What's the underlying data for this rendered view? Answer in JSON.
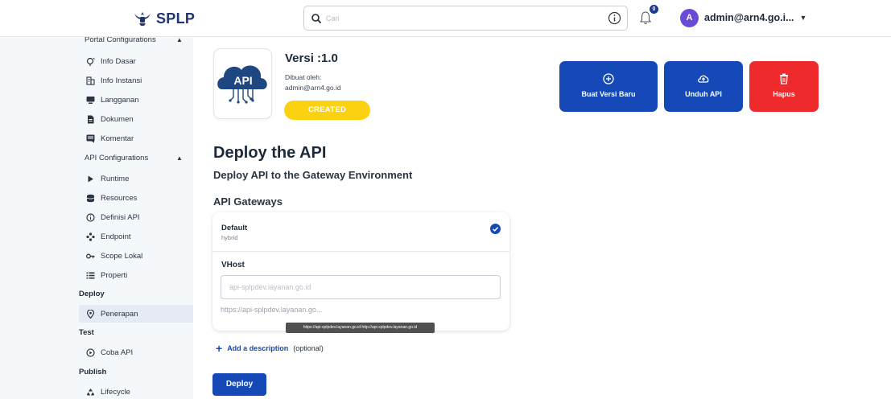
{
  "header": {
    "logo_text": "SPLP",
    "search_placeholder": "Cari",
    "notification_count": "0",
    "user_initial": "A",
    "user_name": "admin@arn4.go.i..."
  },
  "sidebar": {
    "portal_group": "Portal Configurations",
    "portal_items": [
      {
        "label": "Info Dasar",
        "icon": "info-dasar-icon"
      },
      {
        "label": "Info Instansi",
        "icon": "building-icon"
      },
      {
        "label": "Langganan",
        "icon": "subscription-icon"
      },
      {
        "label": "Dokumen",
        "icon": "document-icon"
      },
      {
        "label": "Komentar",
        "icon": "comment-icon"
      }
    ],
    "api_group": "API Configurations",
    "api_items": [
      {
        "label": "Runtime",
        "icon": "play-icon"
      },
      {
        "label": "Resources",
        "icon": "database-icon"
      },
      {
        "label": "Definisi API",
        "icon": "info-icon"
      },
      {
        "label": "Endpoint",
        "icon": "endpoint-icon"
      },
      {
        "label": "Scope Lokal",
        "icon": "key-icon"
      },
      {
        "label": "Properti",
        "icon": "list-icon"
      }
    ],
    "deploy_section": "Deploy",
    "deploy_item": "Penerapan",
    "test_section": "Test",
    "test_item": "Coba API",
    "publish_section": "Publish",
    "publish_item": "Lifecycle"
  },
  "api_info": {
    "logo_text": "API",
    "version": "Versi :1.0",
    "created_by_label": "Dibuat oleh:",
    "created_by": "admin@arn4.go.id",
    "status": "CREATED"
  },
  "actions": {
    "new_version": "Buat Versi Baru",
    "download": "Unduh API",
    "delete": "Hapus"
  },
  "deploy": {
    "title": "Deploy the API",
    "subtitle": "Deploy API to the Gateway Environment",
    "gateways_title": "API Gateways",
    "gateway_name": "Default",
    "gateway_type": "hybrid",
    "vhost_label": "VHost",
    "vhost_placeholder": "api-splpdev.layanan.go.id",
    "vhost_hint": "https://api-splpdev.layanan.go...",
    "tooltip": "https://api-splpdev.layanan.go.id http://api-splpdev.layanan.go.id",
    "add_description": "Add a description",
    "optional": "(optional)",
    "deploy_button": "Deploy"
  },
  "colors": {
    "primary": "#1649b8",
    "danger": "#ee2a2d",
    "status_created": "#fcd210",
    "sidebar_bg": "#f5f8fb"
  }
}
